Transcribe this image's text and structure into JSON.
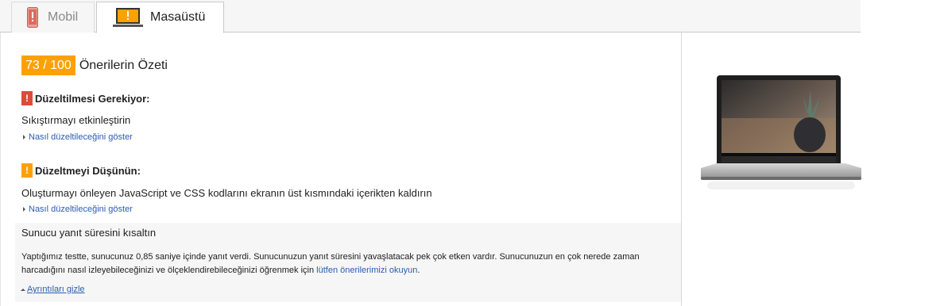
{
  "tabs": [
    {
      "label": "Mobil",
      "icon": "phone-warning-icon",
      "active": false
    },
    {
      "label": "Masaüstü",
      "icon": "laptop-warning-icon",
      "active": true
    }
  ],
  "summary": {
    "score": "73 / 100",
    "title": "Önerilerin Özeti"
  },
  "must_fix": {
    "heading": "Düzeltilmesi Gerekiyor:",
    "badge": "!",
    "item": "Sıkıştırmayı etkinleştirin",
    "link": "Nasıl düzeltileceğini göster"
  },
  "consider_fix": {
    "heading": "Düzeltmeyi Düşünün:",
    "badge": "!",
    "item": "Oluşturmayı önleyen JavaScript ve CSS kodlarını ekranın üst kısmındaki içerikten kaldırın",
    "link": "Nasıl düzeltileceğini göster"
  },
  "expanded_item": {
    "title": "Sunucu yanıt süresini kısaltın",
    "body": "Yaptığımız testte, sunucunuz 0,85 saniye içinde yanıt verdi. Sunucunuzun yanıt süresini yavaşlatacak pek çok etken vardır. Sunucunuzun en çok nerede zaman harcadığını nasıl izleyebileceğinizi ve ölçeklendirebileceğinizi öğrenmek için ",
    "link": "lütfen önerilerimizi okuyun",
    "period": ".",
    "hide_link": "Ayrıntıları gizle"
  },
  "colors": {
    "score_badge": "#fda100",
    "must_fix_badge": "#dd4b39",
    "consider_badge": "#fda100",
    "link": "#2a5db0"
  }
}
